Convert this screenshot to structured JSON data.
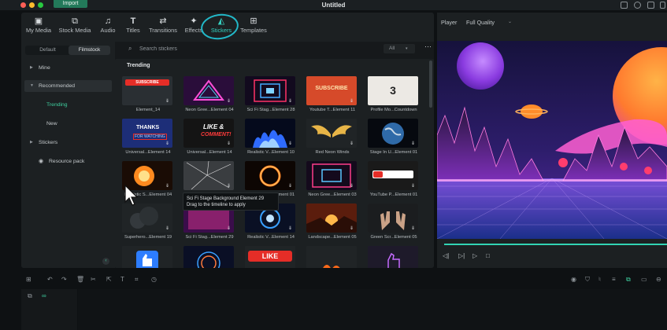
{
  "window": {
    "title": "Untitled",
    "import_label": "Import"
  },
  "tabs": [
    {
      "label": "My Media",
      "icon": "image-icon"
    },
    {
      "label": "Stock Media",
      "icon": "stock-media-icon"
    },
    {
      "label": "Audio",
      "icon": "music-note-icon"
    },
    {
      "label": "Titles",
      "icon": "text-t-icon"
    },
    {
      "label": "Transitions",
      "icon": "transition-arrows-icon"
    },
    {
      "label": "Effects",
      "icon": "sparkle-icon"
    },
    {
      "label": "Stickers",
      "icon": "sticker-icon"
    },
    {
      "label": "Templates",
      "icon": "template-icon"
    }
  ],
  "active_tab": "Stickers",
  "sidebar": {
    "segments": [
      "Default",
      "Filmstock"
    ],
    "active_segment": "Filmstock",
    "items": [
      {
        "label": "Mine"
      },
      {
        "label": "Recommended"
      },
      {
        "label": "Trending"
      },
      {
        "label": "New"
      },
      {
        "label": "Stickers"
      },
      {
        "label": "Resource pack"
      }
    ]
  },
  "search": {
    "placeholder": "Search stickers",
    "filter": "All"
  },
  "section_title": "Trending",
  "grid": [
    {
      "label": "Element_14",
      "thumb": "subscribe-red"
    },
    {
      "label": "Neon Gree...Element 04",
      "thumb": "neon-triangle"
    },
    {
      "label": "Sci Fi Stag...Element 28",
      "thumb": "scifi-tunnel"
    },
    {
      "label": "Youtube T...Element 11",
      "thumb": "subscribe-3d"
    },
    {
      "label": "Profile Mo...Countdown",
      "thumb": "countdown-3"
    },
    {
      "label": "Universal...Element 14",
      "thumb": "thanks-for-watching"
    },
    {
      "label": "Universal...Element 14",
      "thumb": "like-comment"
    },
    {
      "label": "Realistic V...Element 10",
      "thumb": "blue-fire"
    },
    {
      "label": "Red Neon Winds",
      "thumb": "golden-wings"
    },
    {
      "label": "Stage In U...Element 01",
      "thumb": "earth"
    },
    {
      "label": "Realistic S...Element 04",
      "thumb": "explosion"
    },
    {
      "label": "Realistic V...Element 13",
      "thumb": "cracked-glass"
    },
    {
      "label": "Superhero...Element 01",
      "thumb": "fire-ring"
    },
    {
      "label": "Neon Gree...Element 03",
      "thumb": "neon-corridor"
    },
    {
      "label": "YouTube P...Element 01",
      "thumb": "youtube-bar"
    },
    {
      "label": "Superhero...Element 19",
      "thumb": "dark-smoke"
    },
    {
      "label": "Sci Fi Stag...Element 29",
      "thumb": "scifi-stage"
    },
    {
      "label": "Realistic V...Element 14",
      "thumb": "blue-energy"
    },
    {
      "label": "Landscape...Element 05",
      "thumb": "sunset"
    },
    {
      "label": "Green Scr...Element 05",
      "thumb": "hands"
    },
    {
      "label": "",
      "thumb": "thumbs-up"
    },
    {
      "label": "",
      "thumb": "portal-rings"
    },
    {
      "label": "",
      "thumb": "like-button"
    },
    {
      "label": "",
      "thumb": "flames"
    },
    {
      "label": "",
      "thumb": "neon-thumb"
    }
  ],
  "tooltip": {
    "line1": "Sci Fi Stage Background Element 29",
    "line2": "Drag to the timeline to apply"
  },
  "player": {
    "label": "Player",
    "quality": "Full Quality",
    "progress": 1.0
  },
  "thumb_text": {
    "subscribe": "SUBSCRIBE",
    "subscribe2": "SUBSCRIBE",
    "countdown": "3",
    "thanks_line1": "THANKS",
    "thanks_line2": "FOR WATCHING",
    "like_line1": "LIKE &",
    "like_line2": "COMMENT!",
    "like_button": "LIKE"
  }
}
